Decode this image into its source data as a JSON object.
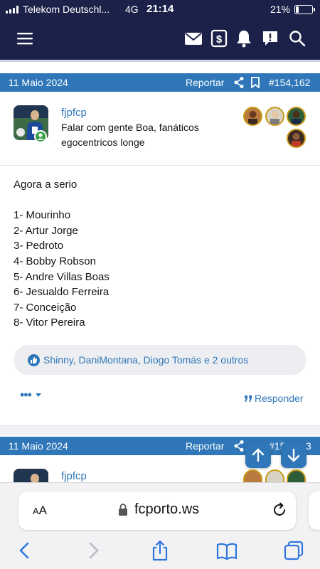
{
  "status_bar": {
    "carrier": "Telekom Deutschl...",
    "network": "4G",
    "time": "21:14",
    "battery_percent": "21%",
    "battery_level": 0.21
  },
  "nav_icons": [
    "menu-icon",
    "mail-icon",
    "dollar-icon",
    "bell-icon",
    "alert-icon",
    "search-icon"
  ],
  "post": {
    "date": "11 Maio 2024",
    "report_label": "Reportar",
    "post_number": "#154,162",
    "username": "fjpfcp",
    "user_title": "Falar com gente Boa, fanáticos egocentricos longe",
    "content_lines": [
      "Agora a serio",
      "",
      "1- Mourinho",
      "2- Artur Jorge",
      "3- Pedroto",
      "4- Bobby Robson",
      "5- Andre Villas Boas",
      "6- Jesualdo Ferreira",
      "7- Conceição",
      "8- Vitor Pereira"
    ],
    "reactions_text": "Shinny, DaniMontana, Diogo Tomás e 2 outros",
    "more_label": "•••",
    "reply_label": "Responder"
  },
  "next_post": {
    "date": "11 Maio 2024",
    "report_label": "Reportar",
    "post_number_partial": "#15",
    "post_number_tail": "3",
    "username": "fjpfcp"
  },
  "browser": {
    "text_size_label": "AA",
    "domain": "fcporto.ws"
  },
  "colors": {
    "navbar": "#1b2148",
    "accent": "#2f77b8",
    "badge_ring": "#c99a19"
  }
}
